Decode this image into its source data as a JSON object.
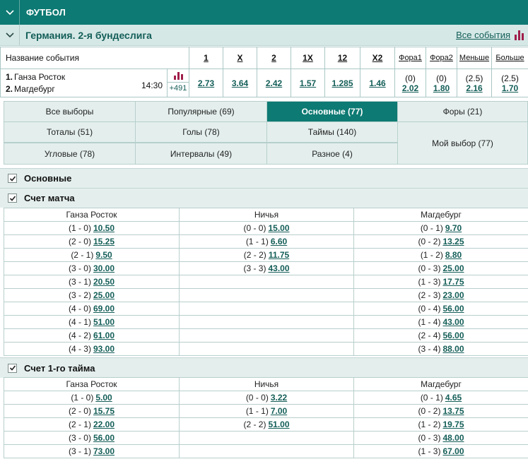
{
  "sport": {
    "title": "ФУТБОЛ"
  },
  "league": {
    "title": "Германия. 2-я бундеслига",
    "all_events": "Все события"
  },
  "odds_table": {
    "headers": {
      "name": "Название события",
      "c1": "1",
      "cx": "X",
      "c2": "2",
      "c1x": "1X",
      "c12": "12",
      "cx2": "X2",
      "fora1": "Фора1",
      "fora2": "Фора2",
      "less": "Меньше",
      "more": "Больше"
    },
    "event": {
      "team1_num": "1.",
      "team1": "Ганза Росток",
      "team2_num": "2.",
      "team2": "Магдебург",
      "time": "14:30",
      "more_count": "+491",
      "odds": {
        "c1": "2.73",
        "cx": "3.64",
        "c2": "2.42",
        "c1x": "1.57",
        "c12": "1.285",
        "cx2": "1.46"
      },
      "fora1": {
        "hcp": "(0)",
        "odd": "2.02"
      },
      "fora2": {
        "hcp": "(0)",
        "odd": "1.80"
      },
      "less": {
        "hcp": "(2.5)",
        "odd": "2.16"
      },
      "more": {
        "hcp": "(2.5)",
        "odd": "1.70"
      }
    }
  },
  "tabs": {
    "all": "Все выборы",
    "popular": "Популярные (69)",
    "main": "Основные (77)",
    "foras": "Форы (21)",
    "totals": "Тоталы (51)",
    "goals": "Голы (78)",
    "halves": "Таймы (140)",
    "my": "Мой выбор (77)",
    "corners": "Угловые (78)",
    "intervals": "Интервалы (49)",
    "misc": "Разное (4)"
  },
  "sections": {
    "main": "Основные",
    "match_score": {
      "title": "Счет матча",
      "headers": [
        "Ганза Росток",
        "Ничья",
        "Магдебург"
      ],
      "rows": [
        [
          [
            "(1 - 0)",
            "10.50"
          ],
          [
            "(0 - 0)",
            "15.00"
          ],
          [
            "(0 - 1)",
            "9.70"
          ]
        ],
        [
          [
            "(2 - 0)",
            "15.25"
          ],
          [
            "(1 - 1)",
            "6.60"
          ],
          [
            "(0 - 2)",
            "13.25"
          ]
        ],
        [
          [
            "(2 - 1)",
            "9.50"
          ],
          [
            "(2 - 2)",
            "11.75"
          ],
          [
            "(1 - 2)",
            "8.80"
          ]
        ],
        [
          [
            "(3 - 0)",
            "30.00"
          ],
          [
            "(3 - 3)",
            "43.00"
          ],
          [
            "(0 - 3)",
            "25.00"
          ]
        ],
        [
          [
            "(3 - 1)",
            "20.50"
          ],
          null,
          [
            "(1 - 3)",
            "17.75"
          ]
        ],
        [
          [
            "(3 - 2)",
            "25.00"
          ],
          null,
          [
            "(2 - 3)",
            "23.00"
          ]
        ],
        [
          [
            "(4 - 0)",
            "69.00"
          ],
          null,
          [
            "(0 - 4)",
            "56.00"
          ]
        ],
        [
          [
            "(4 - 1)",
            "51.00"
          ],
          null,
          [
            "(1 - 4)",
            "43.00"
          ]
        ],
        [
          [
            "(4 - 2)",
            "61.00"
          ],
          null,
          [
            "(2 - 4)",
            "56.00"
          ]
        ],
        [
          [
            "(4 - 3)",
            "93.00"
          ],
          null,
          [
            "(3 - 4)",
            "88.00"
          ]
        ]
      ]
    },
    "first_half": {
      "title": "Счет 1-го тайма",
      "headers": [
        "Ганза Росток",
        "Ничья",
        "Магдебург"
      ],
      "rows": [
        [
          [
            "(1 - 0)",
            "5.00"
          ],
          [
            "(0 - 0)",
            "3.22"
          ],
          [
            "(0 - 1)",
            "4.65"
          ]
        ],
        [
          [
            "(2 - 0)",
            "15.75"
          ],
          [
            "(1 - 1)",
            "7.00"
          ],
          [
            "(0 - 2)",
            "13.75"
          ]
        ],
        [
          [
            "(2 - 1)",
            "22.00"
          ],
          [
            "(2 - 2)",
            "51.00"
          ],
          [
            "(1 - 2)",
            "19.75"
          ]
        ],
        [
          [
            "(3 - 0)",
            "56.00"
          ],
          null,
          [
            "(0 - 3)",
            "48.00"
          ]
        ],
        [
          [
            "(3 - 1)",
            "73.00"
          ],
          null,
          [
            "(1 - 3)",
            "67.00"
          ]
        ]
      ]
    }
  },
  "colors": {
    "accent": "#0d7a73",
    "link": "#145e58",
    "stats": "#a01e4a",
    "light_bg": "#e4efed"
  }
}
